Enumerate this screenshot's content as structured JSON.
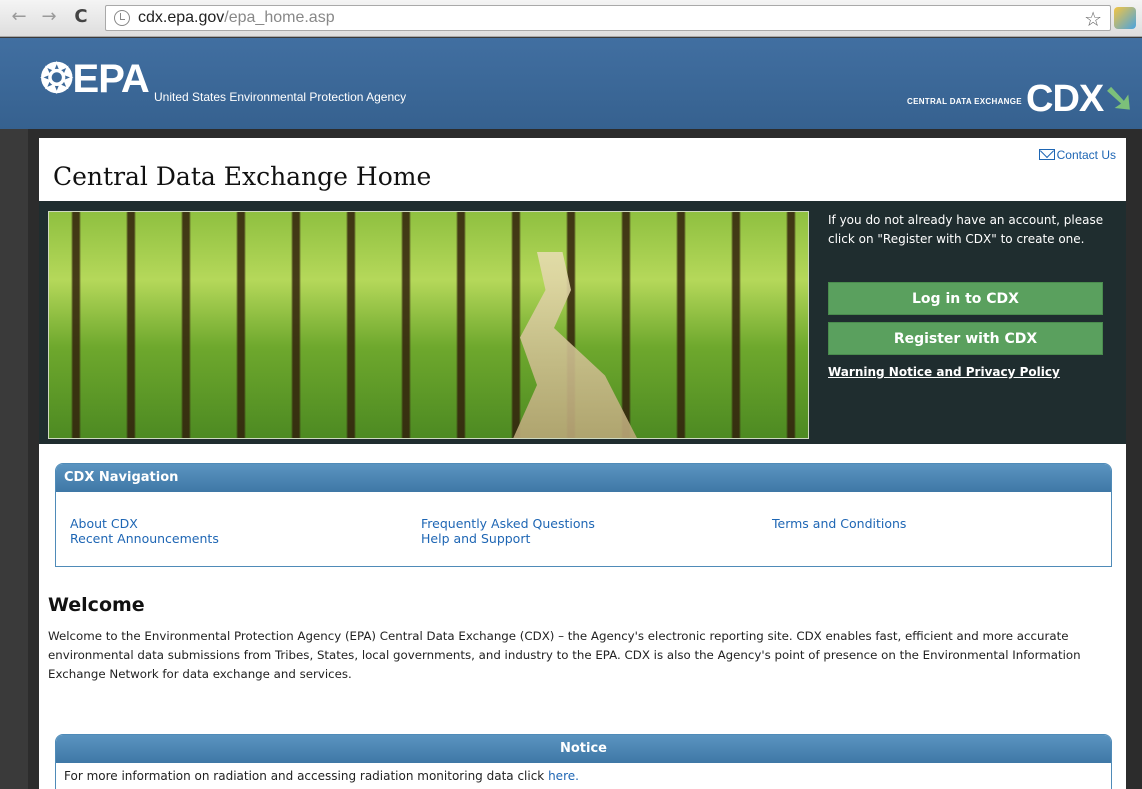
{
  "browser": {
    "url_host": "cdx.epa.gov",
    "url_path": "/epa_home.asp",
    "back_glyph": "←",
    "forward_glyph": "→",
    "reload_glyph": "C",
    "star_glyph": "☆"
  },
  "header": {
    "epa_logo": "EPA",
    "agency_name": "United States Environmental Protection Agency",
    "cdx_subtitle": "CENTRAL DATA EXCHANGE",
    "cdx_logo": "CDX"
  },
  "page": {
    "contact_link": "Contact Us",
    "title": "Central Data Exchange Home"
  },
  "hero": {
    "intro_text": "If you do not already have an account, please click on \"Register with CDX\" to create one.",
    "login_button": "Log in to CDX",
    "register_button": "Register with CDX",
    "warning_link": "Warning Notice and Privacy Policy"
  },
  "cdx_nav": {
    "heading": "CDX Navigation",
    "col1": [
      "About CDX",
      "Recent Announcements"
    ],
    "col2": [
      "Frequently Asked Questions",
      "Help and Support"
    ],
    "col3": [
      "Terms and Conditions"
    ]
  },
  "welcome": {
    "heading": "Welcome",
    "body": "Welcome to the Environmental Protection Agency (EPA) Central Data Exchange (CDX) – the Agency's electronic reporting site. CDX enables fast, efficient and more accurate environmental data submissions from Tribes, States, local governments, and industry to the EPA. CDX is also the Agency's point of presence on the Environmental Information Exchange Network for data exchange and services."
  },
  "notice": {
    "heading": "Notice",
    "text": "For more information on radiation and accessing radiation monitoring data click ",
    "link": "here."
  },
  "colors": {
    "header_blue": "#3a6796",
    "button_green": "#5aa05e",
    "link_blue": "#1e66b4"
  }
}
